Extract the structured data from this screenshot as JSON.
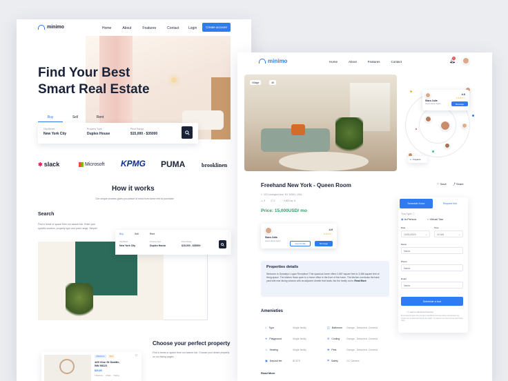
{
  "left": {
    "logo": "minimo",
    "nav": [
      "Home",
      "About",
      "Features",
      "Contact"
    ],
    "login": "Login",
    "create": "Create account",
    "hero_title_1": "Find Your Best",
    "hero_title_2": "Smart Real Estate",
    "tabs": [
      "Buy",
      "Sell",
      "Rent"
    ],
    "fields": [
      {
        "label": "City/Street",
        "value": "New York City"
      },
      {
        "label": "Property Type",
        "value": "Duplex House"
      },
      {
        "label": "Price Range",
        "value": "$15,000 - $35000"
      }
    ],
    "brands": [
      "slack",
      "Microsoft",
      "KPMG",
      "puma",
      "brooklinen"
    ],
    "how_title": "How it works",
    "how_sub": "Our unique process gives you peace of mind from home rent to purchase",
    "search_title": "Search",
    "search_text": "Find a home or space from our search bar. Enter your specific location, property type and price range. Simple!",
    "mini_tabs": [
      "Buy",
      "Sell",
      "Rent"
    ],
    "mini_fields": [
      {
        "label": "City/Street",
        "value": "New York City"
      },
      {
        "label": "Property Type",
        "value": "Duplex House"
      },
      {
        "label": "Price Range",
        "value": "$15,000 - $35000"
      }
    ],
    "choose_title": "Choose your perfect property",
    "choose_text": "Find a home or space from our search bar. Choose your desire property on our listing pages.",
    "card": {
      "badges": [
        "3 Bedroom",
        "Rent"
      ],
      "address_1": "425 Vine St Seattle,",
      "address_2": "WA 98121",
      "price": "$20,60",
      "stats": [
        "3 Bedroom",
        "2 Bath",
        "Parking"
      ]
    }
  },
  "right": {
    "logo": "minimo",
    "nav": [
      "Home",
      "About",
      "Features",
      "Contact"
    ],
    "notif_count": "2",
    "img_tags": [
      "Village",
      "4K"
    ],
    "title": "Freehand New York - Queen Room",
    "save": "Save",
    "share": "Share",
    "address": "123 Lexington Ave, NY 10001, USA",
    "meta": [
      "3",
      "2",
      "4,800 sq. ft."
    ],
    "price": "Price: 15,000USD/ mo",
    "agent": {
      "name": "Slara Julia",
      "role": "Home Owner Agent",
      "rating": "4.0",
      "view_profile": "View Profile",
      "message": "Message"
    },
    "orbit_agent": {
      "name": "Slara Julia",
      "role": "Home Owner Agent",
      "rating": "4.0",
      "message": "Message"
    },
    "orbit_tag": "3 Agents",
    "details_title": "Properties details",
    "details_text": "Welcome to Dynasty's Logan Reception! This spacious home offers 2,687 square feet to 3,386 square feet of living space. The kitchen flows open to a home office in the front of the home. The kitchen overlooks the back yard with rear facing window with an adjacent dinette that leads into the family room.",
    "read_more_inline": "Read More",
    "amenities_title": "Amenieties",
    "amenities": [
      {
        "k": "Type",
        "v": "Single family"
      },
      {
        "k": "Bathroom",
        "v": "Garage - Detached, Covered"
      },
      {
        "k": "Playground",
        "v": "Single family"
      },
      {
        "k": "Cooling",
        "v": "Garage - Detached, Covered"
      },
      {
        "k": "Heating",
        "v": "Single family"
      },
      {
        "k": "Pets",
        "v": "Garage - Detached, Covered"
      },
      {
        "k": "Deposit fee",
        "v": "$2,875"
      },
      {
        "k": "Safety",
        "v": "CC Camera"
      }
    ],
    "read_more": "Read More",
    "schedule": {
      "tab_active": "Schedule A tour",
      "tab_other": "Request Info",
      "tour_type_label": "Tour Type",
      "in_person": "In-Person",
      "virtual": "Virtual Tour",
      "date_label": "Date",
      "date_value": "10/01/2023",
      "time_label": "Time",
      "time_value": "10 AM",
      "name_label": "Name",
      "name_ph": "Name",
      "phone_label": "Phone",
      "phone_ph": "Name",
      "email_label": "Email",
      "email_ph": "Name",
      "submit": "Schedule a tour",
      "financing": "I want to talk about financing",
      "disclaimer": "By pressing Request Info you agree that Minimo and real estate professionals may contact you via phone/text about your inquiry. You agree to our Terms of use and Privacy policy."
    }
  }
}
